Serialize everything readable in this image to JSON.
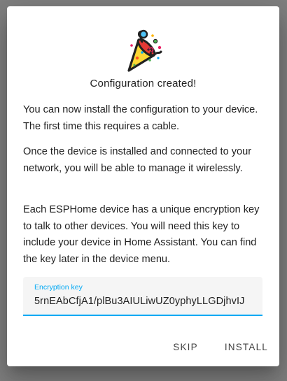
{
  "dialog": {
    "icon": "party-popper-icon",
    "title": "Configuration created!",
    "paragraphs": [
      "You can now install the configuration to your device. The first time this requires a cable.",
      "Once the device is installed and connected to your network, you will be able to manage it wirelessly.",
      "Each ESPHome device has a unique encryption key to talk to other devices. You will need this key to include your device in Home Assistant. You can find the key later in the device menu."
    ],
    "encryption_field": {
      "label": "Encryption key",
      "value": "5rnEAbCfjA1/plBu3AIULiwUZ0yphyLLGDjhvIJ"
    },
    "buttons": {
      "skip": "SKIP",
      "install": "INSTALL"
    }
  },
  "colors": {
    "accent": "#03a9f4",
    "text": "#212121",
    "backdrop": "#808080"
  }
}
